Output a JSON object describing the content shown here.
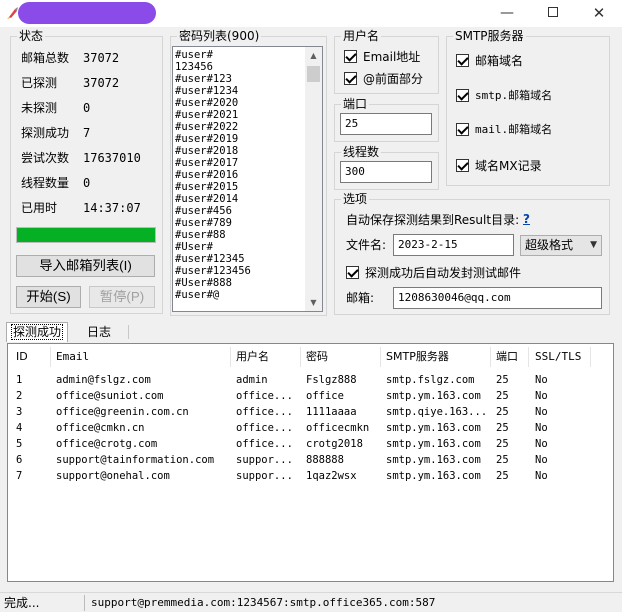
{
  "window": {
    "minimize": "—",
    "close": "✕"
  },
  "status_group": {
    "title": "状态",
    "rows": [
      {
        "label": "邮箱总数",
        "value": "37072"
      },
      {
        "label": "已探测",
        "value": "37072"
      },
      {
        "label": "未探测",
        "value": "0"
      },
      {
        "label": "探测成功",
        "value": "7"
      },
      {
        "label": "尝试次数",
        "value": "17637010"
      },
      {
        "label": "线程数量",
        "value": "0"
      },
      {
        "label": "已用时",
        "value": "14:37:07"
      }
    ],
    "progress": 1.0,
    "progress_color": "#06b025",
    "import_button": "导入邮箱列表(I)",
    "start_button": "开始(S)",
    "pause_button": "暂停(P)"
  },
  "password_group": {
    "title": "密码列表(900)",
    "lines": [
      "#user#",
      "123456",
      "#user#123",
      "#user#1234",
      "#user#2020",
      "#user#2021",
      "#user#2022",
      "#user#2019",
      "#user#2018",
      "#user#2017",
      "#user#2016",
      "#user#2015",
      "#user#2014",
      "#user#456",
      "#user#789",
      "#user#88",
      "#User#",
      "#user#12345",
      "#user#123456",
      "#User#888",
      "#user#@"
    ]
  },
  "username_group": {
    "title": "用户名",
    "options": [
      {
        "label": "Email地址",
        "checked": true
      },
      {
        "label": "@前面部分",
        "checked": true
      }
    ]
  },
  "smtp_group": {
    "title": "SMTP服务器",
    "options": [
      {
        "label": "邮箱域名",
        "checked": true
      },
      {
        "label": "smtp.邮箱域名",
        "checked": true
      },
      {
        "label": "mail.邮箱域名",
        "checked": true
      },
      {
        "label": "域名MX记录",
        "checked": true
      }
    ]
  },
  "port_group": {
    "title": "端口",
    "value": "25"
  },
  "threads_group": {
    "title": "线程数",
    "value": "300"
  },
  "options_group": {
    "title": "选项",
    "autosave_label": "自动保存探测结果到Result目录:",
    "help": "?",
    "filename_label": "文件名:",
    "filename_value": "2023-2-15",
    "format_value": "超级格式",
    "autosend_label": "探测成功后自动发封测试邮件",
    "autosend_checked": true,
    "mailbox_label": "邮箱:",
    "mailbox_value": "1208630046@qq.com"
  },
  "tabs": [
    {
      "label": "探测成功",
      "active": true
    },
    {
      "label": "日志",
      "active": false
    }
  ],
  "table": {
    "columns": [
      "ID",
      "Email",
      "用户名",
      "密码",
      "SMTP服务器",
      "端口",
      "SSL/TLS"
    ],
    "rows": [
      [
        "1",
        "admin@fslgz.com",
        "admin",
        "Fslgz888",
        "smtp.fslgz.com",
        "25",
        "No"
      ],
      [
        "2",
        "office@suniot.com",
        "office...",
        "office",
        "smtp.ym.163.com",
        "25",
        "No"
      ],
      [
        "3",
        "office@greenin.com.cn",
        "office...",
        "1111aaaa",
        "smtp.qiye.163...",
        "25",
        "No"
      ],
      [
        "4",
        "office@cmkn.cn",
        "office...",
        "officecmkn",
        "smtp.ym.163.com",
        "25",
        "No"
      ],
      [
        "5",
        "office@crotg.com",
        "office...",
        "crotg2018",
        "smtp.ym.163.com",
        "25",
        "No"
      ],
      [
        "6",
        "support@tainformation.com",
        "suppor...",
        "888888",
        "smtp.ym.163.com",
        "25",
        "No"
      ],
      [
        "7",
        "support@onehal.com",
        "suppor...",
        "1qaz2wsx",
        "smtp.ym.163.com",
        "25",
        "No"
      ]
    ]
  },
  "statusbar": {
    "left": "完成...",
    "right": "support@premmedia.com:1234567:smtp.office365.com:587"
  }
}
